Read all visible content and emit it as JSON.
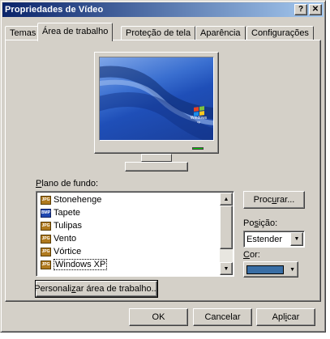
{
  "window": {
    "title": "Propriedades de Vídeo",
    "help_button": "?",
    "close_button": "✕"
  },
  "tabs": [
    {
      "label": "Temas",
      "active": false
    },
    {
      "label": "Área de trabalho",
      "active": true
    },
    {
      "label": "Proteção de tela",
      "active": false
    },
    {
      "label": "Aparência",
      "active": false
    },
    {
      "label": "Configurações",
      "active": false
    }
  ],
  "preview": {
    "logo_line1": "Windows",
    "logo_line2": "xp"
  },
  "background": {
    "label_pre": "P",
    "label_rest": "lano de fundo:",
    "items": [
      {
        "label": "Stonehenge",
        "icon": "jpg-file-icon",
        "icon_text": "JPG"
      },
      {
        "label": "Tapete",
        "icon": "bmp-file-icon",
        "icon_text": "BMP"
      },
      {
        "label": "Tulipas",
        "icon": "jpg-file-icon",
        "icon_text": "JPG"
      },
      {
        "label": "Vento",
        "icon": "jpg-file-icon",
        "icon_text": "JPG"
      },
      {
        "label": "Vórtice",
        "icon": "jpg-file-icon",
        "icon_text": "JPG"
      },
      {
        "label": "Windows XP",
        "icon": "jpg-file-icon",
        "icon_text": "JPG",
        "selected": true
      }
    ],
    "browse_pre": "Proc",
    "browse_u": "u",
    "browse_post": "rar...",
    "position_pre": "Po",
    "position_u": "s",
    "position_post": "ição:",
    "position_value": "Estender",
    "color_u": "C",
    "color_post": "or:",
    "color_value": "#3a6ea5",
    "customize_pre": "Personali",
    "customize_u": "z",
    "customize_post": "ar área de trabalho..."
  },
  "footer": {
    "ok": "OK",
    "cancel": "Cancelar",
    "apply_pre": "Apl",
    "apply_u": "i",
    "apply_post": "car"
  }
}
